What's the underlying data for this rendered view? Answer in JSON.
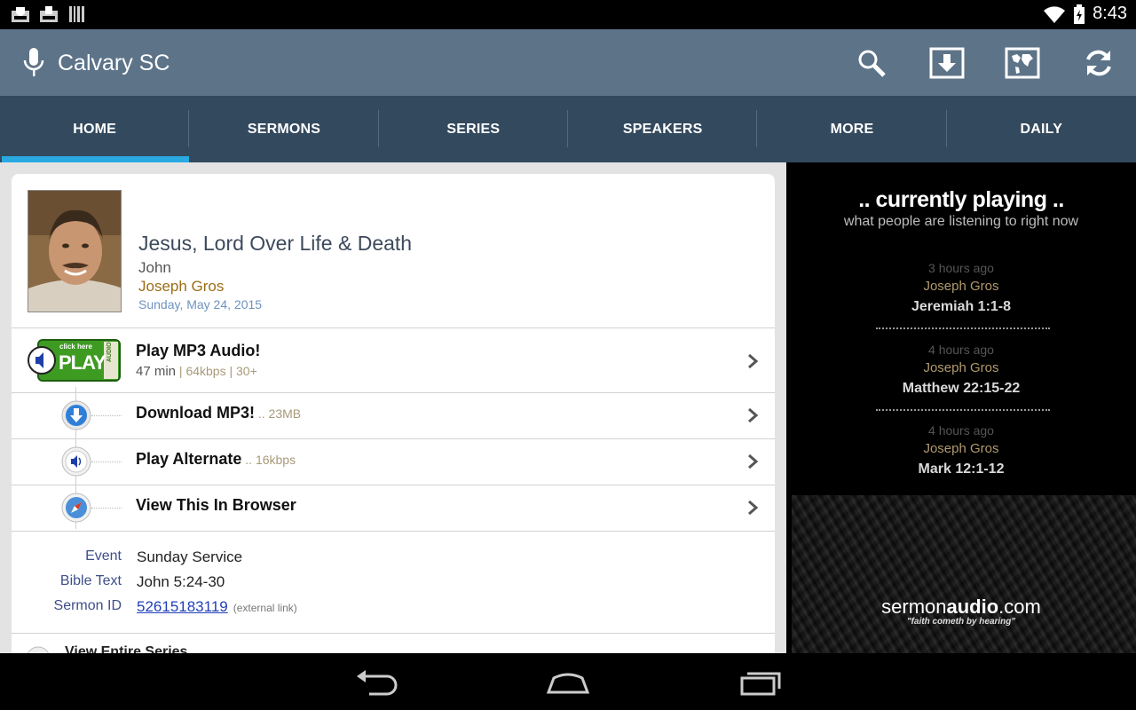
{
  "status_bar": {
    "time": "8:43"
  },
  "app_bar": {
    "title": "Calvary SC"
  },
  "tabs": [
    {
      "label": "HOME"
    },
    {
      "label": "SERMONS"
    },
    {
      "label": "SERIES"
    },
    {
      "label": "SPEAKERS"
    },
    {
      "label": "MORE"
    },
    {
      "label": "DAILY"
    }
  ],
  "sermon": {
    "title": "Jesus, Lord Over Life & Death",
    "book": "John",
    "speaker": "Joseph Gros",
    "date": "Sunday, May 24, 2015"
  },
  "actions": {
    "play_mp3": {
      "label": "Play MP3 Audio!",
      "duration": "47 min",
      "meta": " | 64kbps | 30+",
      "button_small": "click here",
      "button_big": "PLAY",
      "button_side": "AUDIO"
    },
    "download": {
      "label": "Download MP3!",
      "meta": " .. 23MB"
    },
    "play_alternate": {
      "label": "Play Alternate",
      "meta": " .. 16kbps"
    },
    "browser": {
      "label": "View This In Browser"
    }
  },
  "info": {
    "event_label": "Event",
    "event_value": "Sunday Service",
    "bible_label": "Bible Text",
    "bible_value": "John 5:24-30",
    "id_label": "Sermon ID",
    "id_value": "52615183119",
    "id_note": "(external link)"
  },
  "series_link": "View Entire Series",
  "currently_playing": {
    "title": ".. currently playing ..",
    "subtitle": "what people are listening to right now",
    "items": [
      {
        "ago": "3 hours ago",
        "speaker": "Joseph Gros",
        "ref": "Jeremiah 1:1-8"
      },
      {
        "ago": "4 hours ago",
        "speaker": "Joseph Gros",
        "ref": "Matthew 22:15-22"
      },
      {
        "ago": "4 hours ago",
        "speaker": "Joseph Gros",
        "ref": "Mark 12:1-12"
      }
    ]
  },
  "branding": {
    "logo_light": "sermon",
    "logo_bold": "audio",
    "logo_tail": ".com",
    "tagline": "\"faith cometh by hearing\""
  },
  "colors": {
    "action_bar": "#5d7388",
    "tab_bar": "#33495e",
    "tab_indicator": "#29a9e1",
    "speaker": "#9b6e18"
  }
}
